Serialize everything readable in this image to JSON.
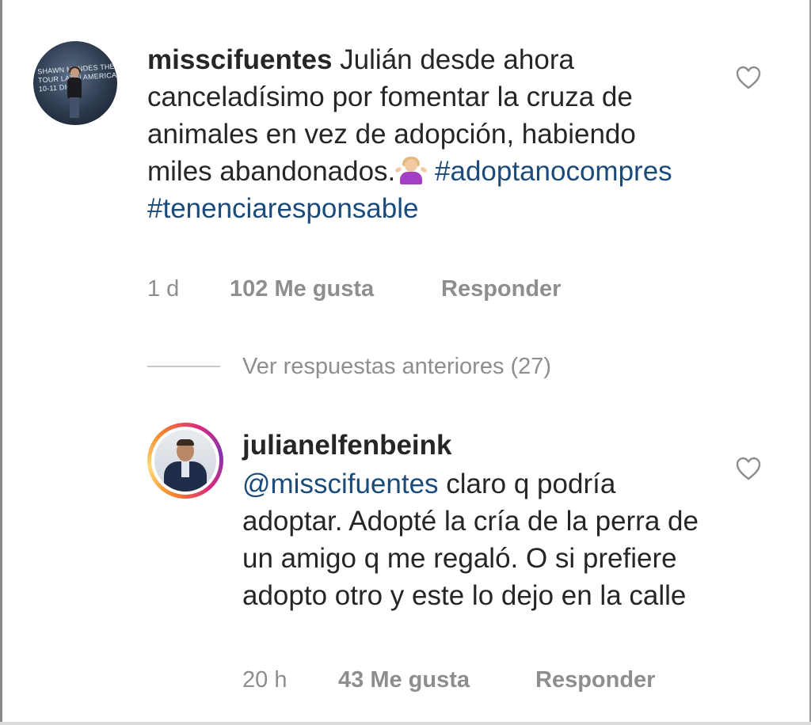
{
  "comments": [
    {
      "username": "misscifuentes",
      "text": "Julián desde ahora canceladísimo por fomentar la cruza de animales en vez de adopción, habiendo miles abandonados.",
      "emoji": "person-shrugging-emoji",
      "hashtags": [
        "#adoptanocompres",
        "#tenenciaresponsable"
      ],
      "time": "1 d",
      "likes": "102 Me gusta",
      "reply_label": "Responder",
      "avatar_text": "SHAWN MENDES THE TOUR LATIN AMERICA 10-11 DIC"
    },
    {
      "username": "julianelfenbeink",
      "mention": "@misscifuentes",
      "text": "claro q podría adoptar. Adopté la cría de la perra de un amigo q me regaló. O si prefiere adopto otro y este lo dejo en la calle",
      "time": "20 h",
      "likes": "43 Me gusta",
      "reply_label": "Responder"
    }
  ],
  "view_previous_replies": "Ver respuestas anteriores (27)",
  "icons": {
    "like": "heart-outline-icon"
  },
  "colors": {
    "text": "#262626",
    "secondary": "#8e8e8e",
    "link": "#1b4b7a"
  }
}
